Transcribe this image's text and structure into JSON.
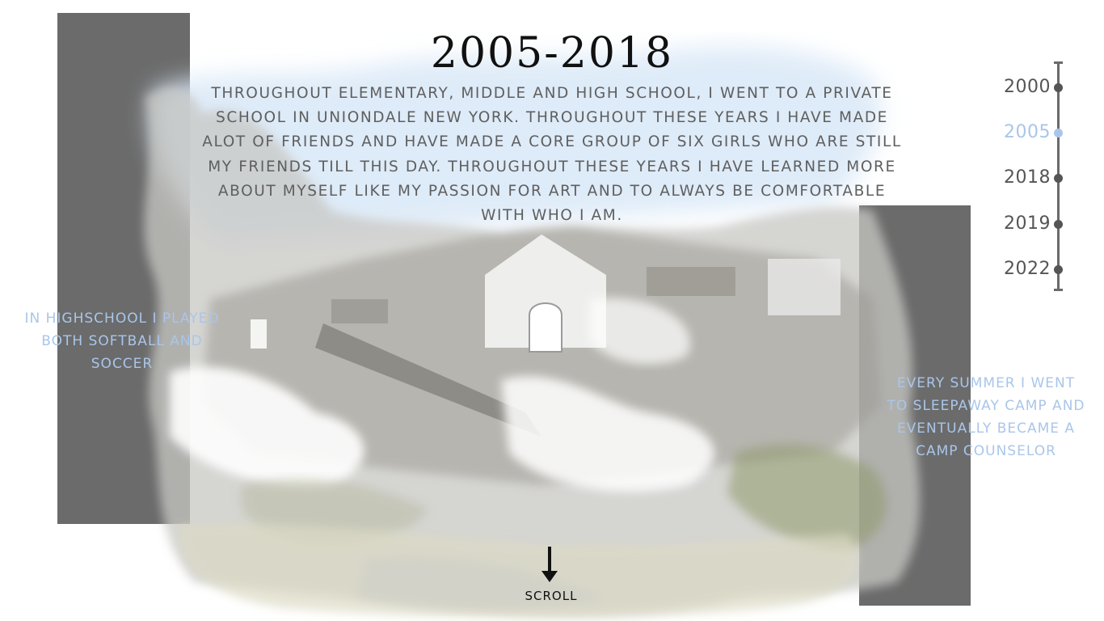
{
  "header": {
    "title": "2005-2018"
  },
  "main": {
    "description": "THROUGHOUT ELEMENTARY, MIDDLE AND HIGH SCHOOL, I WENT TO A PRIVATE SCHOOL IN UNIONDALE NEW YORK. THROUGHOUT THESE YEARS I HAVE MADE ALOT OF FRIENDS AND HAVE MADE A CORE GROUP OF SIX GIRLS WHO ARE STILL MY FRIENDS TILL THIS DAY. THROUGHOUT THESE YEARS I HAVE LEARNED MORE ABOUT MYSELF LIKE MY PASSION FOR ART AND TO ALWAYS BE COMFORTABLE WITH WHO I AM.",
    "caption_left": "IN HIGHSCHOOL I PLAYED BOTH SOFTBALL AND SOCCER",
    "caption_right": "EVERY SUMMER I WENT TO SLEEPAWAY CAMP AND EVENTUALLY BECAME A CAMP COUNSELOR"
  },
  "timeline": {
    "items": [
      {
        "label": "2000",
        "active": false
      },
      {
        "label": "2005",
        "active": true
      },
      {
        "label": "2018",
        "active": false
      },
      {
        "label": "2019",
        "active": false
      },
      {
        "label": "2022",
        "active": false
      }
    ]
  },
  "scroll": {
    "label": "SCROLL",
    "icon": "arrow-down-icon"
  },
  "colors": {
    "accent": "#a9c6ea",
    "panel": "#6b6b6b",
    "text": "#5f5f5f",
    "title": "#111111"
  }
}
